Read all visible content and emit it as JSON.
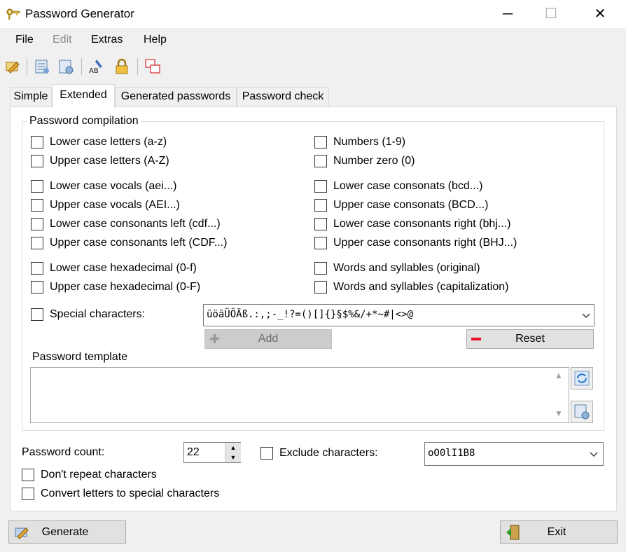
{
  "window": {
    "title": "Password Generator",
    "icon": "keys-icon"
  },
  "window_controls": {
    "minimize": "─",
    "maximize": "☐",
    "close": "✕"
  },
  "menu": [
    "File",
    "Edit",
    "Extras",
    "Help"
  ],
  "toolbar": [
    "key-pencil-icon",
    "list-icon",
    "gear-list-icon",
    "spellcheck-icon",
    "lock-icon",
    "windows-icon"
  ],
  "tabs": [
    "Simple",
    "Extended",
    "Generated passwords",
    "Password check"
  ],
  "active_tab": "Extended",
  "compilation": {
    "label": "Password compilation",
    "left": [
      "Lower case letters (a-z)",
      "Upper case letters (A-Z)",
      "Lower case vocals (aei...)",
      "Upper case vocals (AEI...)",
      "Lower case consonants left (cdf...)",
      "Upper case consonants left (CDF...)",
      "Lower case hexadecimal (0-f)",
      "Upper case hexadecimal (0-F)"
    ],
    "right": [
      "Numbers (1-9)",
      "Number zero (0)",
      "Lower case consonats (bcd...)",
      "Upper case consonats (BCD...)",
      "Lower case consonants right (bhj...)",
      "Upper case consonants right (BHJ...)",
      "Words and syllables (original)",
      "Words and syllables (capitalization)"
    ],
    "special_label": "Special characters:",
    "special_value": "üöäÜÖÄß.:,;-_!?=()[]{}§$%&/+*~#|<>@",
    "add_label": "Add",
    "reset_label": "Reset"
  },
  "template": {
    "label": "Password template",
    "value": ""
  },
  "options": {
    "count_label": "Password count:",
    "count_value": "22",
    "exclude_label": "Exclude characters:",
    "exclude_value": "oO0lI1B8",
    "no_repeat_label": "Don't repeat characters",
    "convert_label": "Convert letters to special characters"
  },
  "buttons": {
    "generate": "Generate",
    "exit": "Exit"
  },
  "colors": {
    "accent": "#0078d7",
    "reset_red": "#e81123",
    "disabled_bg": "#cccccc"
  }
}
